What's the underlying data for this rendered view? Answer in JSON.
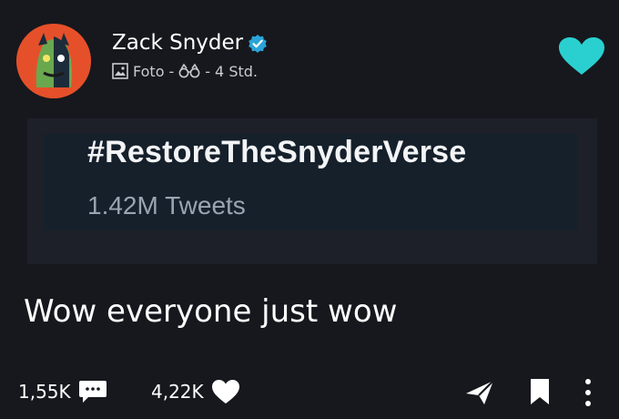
{
  "post": {
    "author_name": "Zack Snyder",
    "verified": true,
    "post_type": "Foto",
    "separator_1": "-",
    "separator_2": "-",
    "time_ago": "4 Std.",
    "embed": {
      "hashtag": "#RestoreTheSnyderVerse",
      "tweet_count": "1.42M Tweets"
    },
    "text": "Wow everyone just wow"
  },
  "actions": {
    "comments_count": "1,55K",
    "likes_count": "4,22K"
  },
  "icons": {
    "avatar": "avatar",
    "verified": "verified-check-icon",
    "photo": "photo-icon",
    "binoculars": "binoculars-icon",
    "favorite": "heart-icon",
    "comment": "comment-bubble-icon",
    "like": "heart-icon",
    "share": "paper-plane-icon",
    "save": "bookmark-icon",
    "more": "vertical-dots-icon"
  },
  "colors": {
    "background": "#16181d",
    "accent": "#2ad0cf",
    "verified": "#2ba4d8",
    "avatar_bg": "#e5502a"
  }
}
